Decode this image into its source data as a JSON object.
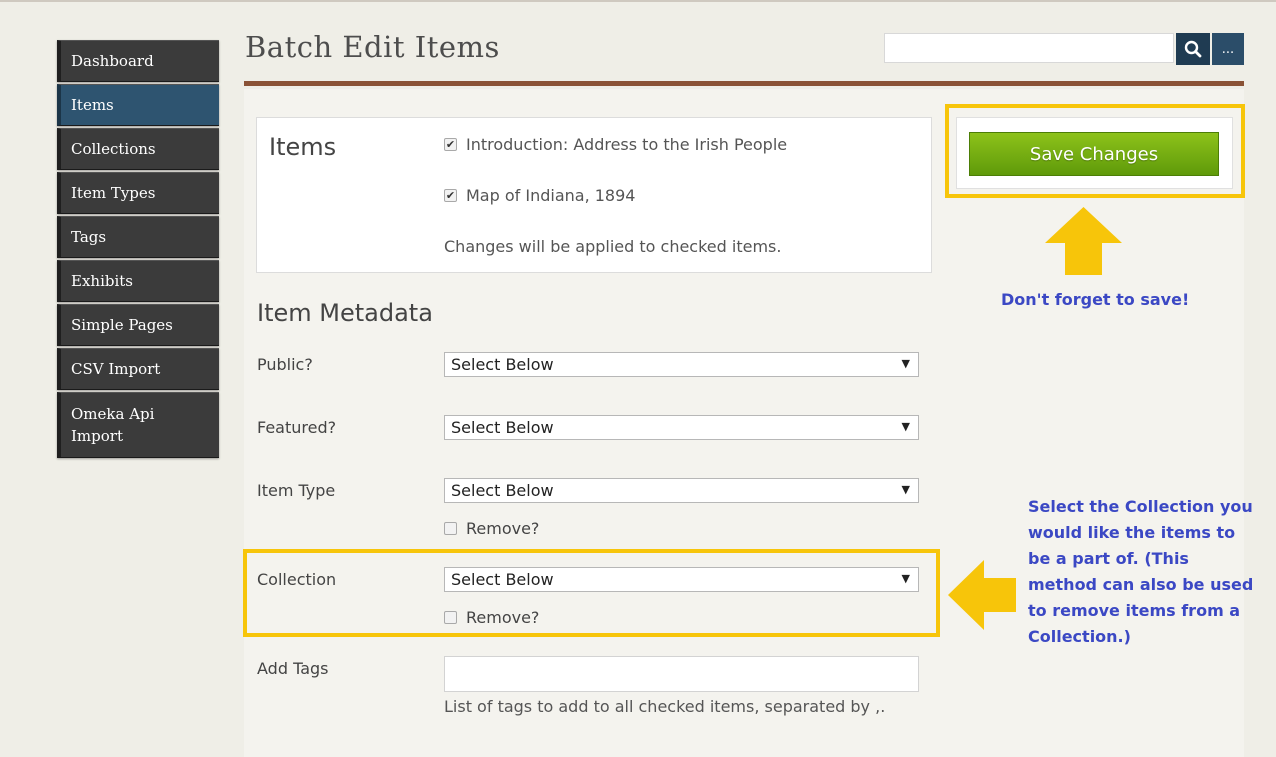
{
  "sidebar": {
    "items": [
      {
        "label": "Dashboard"
      },
      {
        "label": "Items"
      },
      {
        "label": "Collections"
      },
      {
        "label": "Item Types"
      },
      {
        "label": "Tags"
      },
      {
        "label": "Exhibits"
      },
      {
        "label": "Simple Pages"
      },
      {
        "label": "CSV Import"
      },
      {
        "label": "Omeka Api Import"
      }
    ],
    "active_item": "Items"
  },
  "header": {
    "title": "Batch Edit Items",
    "search_value": "",
    "more_label": "..."
  },
  "items_panel": {
    "heading": "Items",
    "items": [
      {
        "label": "Introduction: Address to the Irish People",
        "checked": true
      },
      {
        "label": "Map of Indiana, 1894",
        "checked": true
      }
    ],
    "note": "Changes will be applied to checked items."
  },
  "save": {
    "label": "Save Changes",
    "annotation": "Don't forget to save!"
  },
  "metadata": {
    "heading": "Item Metadata",
    "public": {
      "label": "Public?",
      "value": "Select Below"
    },
    "featured": {
      "label": "Featured?",
      "value": "Select Below"
    },
    "item_type": {
      "label": "Item Type",
      "value": "Select Below",
      "remove_label": "Remove?"
    },
    "collection": {
      "label": "Collection",
      "value": "Select Below",
      "remove_label": "Remove?"
    },
    "tags": {
      "label": "Add Tags",
      "value": "",
      "help": "List of tags to add to all checked items, separated by ,."
    }
  },
  "annotations": {
    "collection_note": [
      "Select the Collection you",
      "would like the items to",
      "be a part of. (This",
      "method can also be used",
      "to remove items from a",
      "Collection.)"
    ]
  },
  "colors": {
    "nav_dark": "#3b3b3b",
    "nav_active": "#2e5470",
    "save_green": "#7cb414",
    "highlight_yellow": "#f7c50a",
    "annotation_blue": "#3b48c4",
    "title_rule": "#8a5236"
  },
  "icons": {
    "search": "search-icon",
    "check": "checkbox-checked-icon",
    "dropdown": "dropdown-arrow-icon",
    "arrow_up": "arrow-up-icon",
    "arrow_left": "arrow-left-icon"
  }
}
